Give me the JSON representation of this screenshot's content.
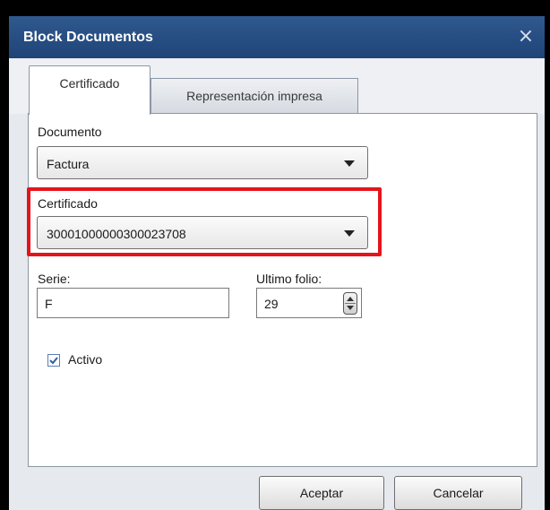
{
  "window": {
    "title": "Block Documentos",
    "close_glyph": "×"
  },
  "tabs": [
    {
      "label": "Certificado",
      "active": true
    },
    {
      "label": "Representación impresa",
      "active": false
    }
  ],
  "form": {
    "documento_label": "Documento",
    "documento_value": "Factura",
    "certificado_label": "Certificado",
    "certificado_value": "30001000000300023708",
    "serie_label": "Serie:",
    "serie_value": "F",
    "folio_label": "Ultimo folio:",
    "folio_value": "29",
    "activo_label": "Activo",
    "activo_checked": true
  },
  "buttons": {
    "accept": "Aceptar",
    "cancel": "Cancelar"
  },
  "colors": {
    "titlebar": "#234a7f",
    "highlight": "#e5141b"
  }
}
